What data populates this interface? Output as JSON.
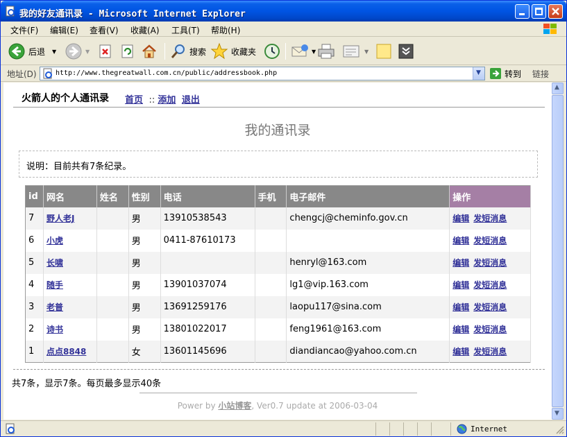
{
  "window": {
    "title": "我的好友通讯录 - Microsoft Internet Explorer"
  },
  "menu": [
    "文件(F)",
    "编辑(E)",
    "查看(V)",
    "收藏(A)",
    "工具(T)",
    "帮助(H)"
  ],
  "toolbar": {
    "back": "后退",
    "search": "搜索",
    "favorites": "收藏夹"
  },
  "address": {
    "label": "地址(D)",
    "url": "http://www.thegreatwall.com.cn/public/addressbook.php",
    "go": "转到",
    "links": "链接"
  },
  "status": {
    "zone": "Internet"
  },
  "page": {
    "site_title": "火箭人的个人通讯录",
    "nav": {
      "home": "首页",
      "sep": "::",
      "add": "添加",
      "logout": "退出"
    },
    "heading": "我的通讯录",
    "note": "说明：目前共有7条纪录。",
    "table": {
      "headers": [
        "id",
        "网名",
        "姓名",
        "性别",
        "电话",
        "手机",
        "电子邮件",
        "操作"
      ],
      "rows": [
        {
          "id": "7",
          "nick": "野人老J",
          "name": "",
          "gender": "男",
          "phone": "13910538543",
          "mobile": "",
          "email": "chengcj@cheminfo.gov.cn",
          "edit": "编辑",
          "sms": "发短消息"
        },
        {
          "id": "6",
          "nick": "小虎",
          "name": "",
          "gender": "男",
          "phone": "0411-87610173",
          "mobile": "",
          "email": "",
          "edit": "编辑",
          "sms": "发短消息"
        },
        {
          "id": "5",
          "nick": "长啸",
          "name": "",
          "gender": "男",
          "phone": "",
          "mobile": "",
          "email": "henryl@163.com",
          "edit": "编辑",
          "sms": "发短消息"
        },
        {
          "id": "4",
          "nick": "随手",
          "name": "",
          "gender": "男",
          "phone": "13901037074",
          "mobile": "",
          "email": "lg1@vip.163.com",
          "edit": "编辑",
          "sms": "发短消息"
        },
        {
          "id": "3",
          "nick": "老普",
          "name": "",
          "gender": "男",
          "phone": "13691259176",
          "mobile": "",
          "email": "laopu117@sina.com",
          "edit": "编辑",
          "sms": "发短消息"
        },
        {
          "id": "2",
          "nick": "诗书",
          "name": "",
          "gender": "男",
          "phone": "13801022017",
          "mobile": "",
          "email": "feng1961@163.com",
          "edit": "编辑",
          "sms": "发短消息"
        },
        {
          "id": "1",
          "nick": "点点8848",
          "name": "",
          "gender": "女",
          "phone": "13601145696",
          "mobile": "",
          "email": "diandiancao@yahoo.com.cn",
          "edit": "编辑",
          "sms": "发短消息"
        }
      ]
    },
    "summary": "共7条，显示7条。每页最多显示40条",
    "footer": {
      "prefix": "Power by ",
      "link": "小站博客",
      "suffix": ", Ver0.7 update at 2006-03-04"
    }
  }
}
